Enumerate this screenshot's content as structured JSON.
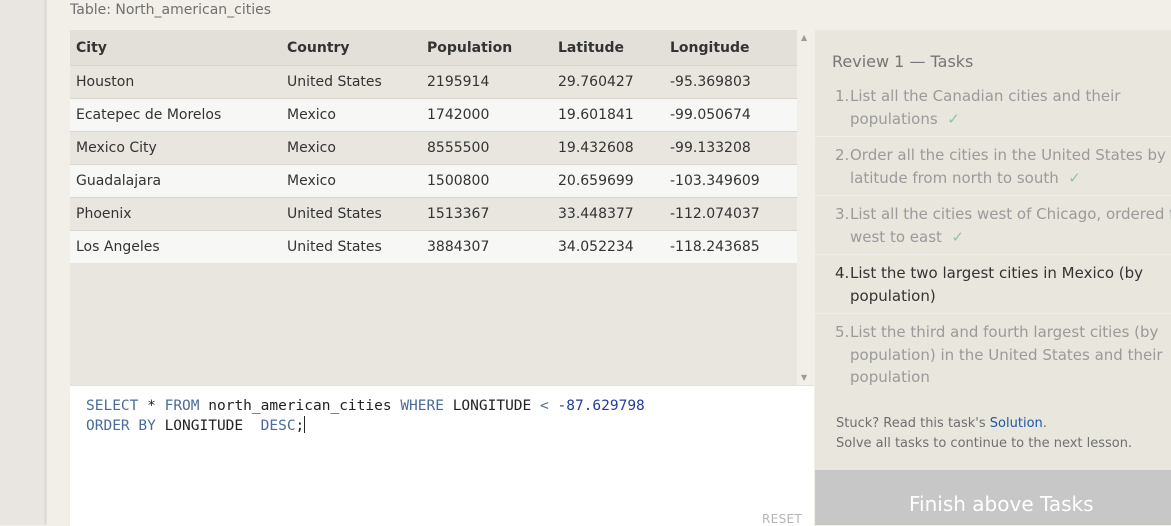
{
  "table": {
    "caption": "Table: North_american_cities",
    "columns": [
      "City",
      "Country",
      "Population",
      "Latitude",
      "Longitude"
    ],
    "rows": [
      [
        "Houston",
        "United States",
        "2195914",
        "29.760427",
        "-95.369803"
      ],
      [
        "Ecatepec de Morelos",
        "Mexico",
        "1742000",
        "19.601841",
        "-99.050674"
      ],
      [
        "Mexico City",
        "Mexico",
        "8555500",
        "19.432608",
        "-99.133208"
      ],
      [
        "Guadalajara",
        "Mexico",
        "1500800",
        "20.659699",
        "-103.349609"
      ],
      [
        "Phoenix",
        "United States",
        "1513367",
        "33.448377",
        "-112.074037"
      ],
      [
        "Los Angeles",
        "United States",
        "3884307",
        "34.052234",
        "-118.243685"
      ]
    ]
  },
  "editor": {
    "line1": {
      "kw1": "SELECT",
      "star": "*",
      "kw2": "FROM",
      "table": "north_american_cities",
      "kw3": "WHERE",
      "col": "LONGITUDE",
      "op": "<",
      "value": "-87.629798"
    },
    "line2": {
      "kw1": "ORDER BY",
      "col": "LONGITUDE",
      "kw2": "DESC",
      "end": ";"
    },
    "reset_label": "RESET"
  },
  "review": {
    "title": "Review 1 — Tasks",
    "tasks": [
      {
        "num": "1.",
        "line1": "List all the Canadian cities and their",
        "line2": "populations",
        "done": "✓"
      },
      {
        "num": "2.",
        "line1": "Order all the cities in the United States by their",
        "line2": "latitude from north to south",
        "done": "✓"
      },
      {
        "num": "3.",
        "line1": "List all the cities west of Chicago, ordered from",
        "line2": "west to east",
        "done": "✓"
      },
      {
        "num": "4.",
        "line1": "List the two largest cities in Mexico (by",
        "line2": "population)"
      },
      {
        "num": "5.",
        "line1": "List the third and fourth largest cities (by",
        "line2": "population) in the United States and their",
        "line3": "population"
      }
    ],
    "stuck_prefix": "Stuck? Read this task's ",
    "solution_link": "Solution",
    "stuck_suffix": ".",
    "solve_all": "Solve all tasks to continue to the next lesson."
  },
  "finish_button": "Finish above Tasks",
  "colors": {
    "check": "#8fc79a",
    "link": "#1f57a6",
    "keyword": "#4a6b9a",
    "number": "#223c9b"
  }
}
